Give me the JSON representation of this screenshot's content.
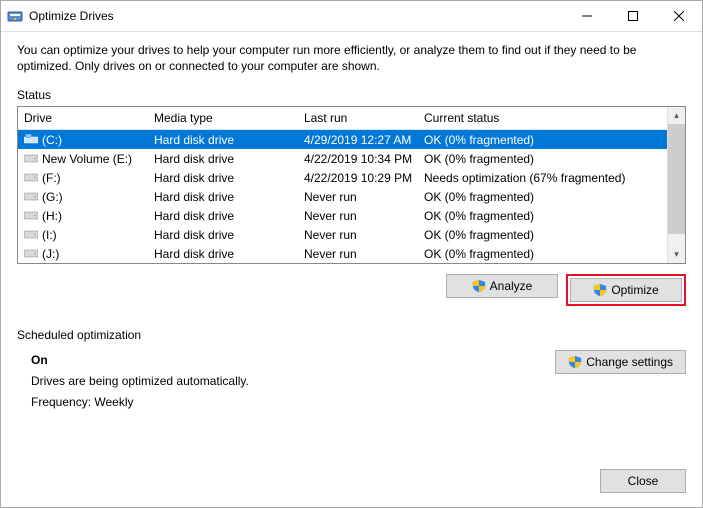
{
  "window": {
    "title": "Optimize Drives",
    "description": "You can optimize your drives to help your computer run more efficiently, or analyze them to find out if they need to be optimized. Only drives on or connected to your computer are shown."
  },
  "status": {
    "label": "Status",
    "columns": {
      "drive": "Drive",
      "media": "Media type",
      "last": "Last run",
      "status": "Current status"
    },
    "rows": [
      {
        "drive": "(C:)",
        "media": "Hard disk drive",
        "last": "4/29/2019 12:27 AM",
        "status": "OK (0% fragmented)",
        "selected": true,
        "iconType": "system"
      },
      {
        "drive": "New Volume (E:)",
        "media": "Hard disk drive",
        "last": "4/22/2019 10:34 PM",
        "status": "OK (0% fragmented)",
        "selected": false,
        "iconType": "disk"
      },
      {
        "drive": "(F:)",
        "media": "Hard disk drive",
        "last": "4/22/2019 10:29 PM",
        "status": "Needs optimization (67% fragmented)",
        "selected": false,
        "iconType": "disk"
      },
      {
        "drive": "(G:)",
        "media": "Hard disk drive",
        "last": "Never run",
        "status": "OK (0% fragmented)",
        "selected": false,
        "iconType": "disk"
      },
      {
        "drive": "(H:)",
        "media": "Hard disk drive",
        "last": "Never run",
        "status": "OK (0% fragmented)",
        "selected": false,
        "iconType": "disk"
      },
      {
        "drive": "(I:)",
        "media": "Hard disk drive",
        "last": "Never run",
        "status": "OK (0% fragmented)",
        "selected": false,
        "iconType": "disk"
      },
      {
        "drive": "(J:)",
        "media": "Hard disk drive",
        "last": "Never run",
        "status": "OK (0% fragmented)",
        "selected": false,
        "iconType": "disk"
      }
    ]
  },
  "buttons": {
    "analyze": "Analyze",
    "optimize": "Optimize",
    "change_settings": "Change settings",
    "close": "Close"
  },
  "scheduled": {
    "label": "Scheduled optimization",
    "state": "On",
    "desc": "Drives are being optimized automatically.",
    "frequency": "Frequency: Weekly"
  }
}
